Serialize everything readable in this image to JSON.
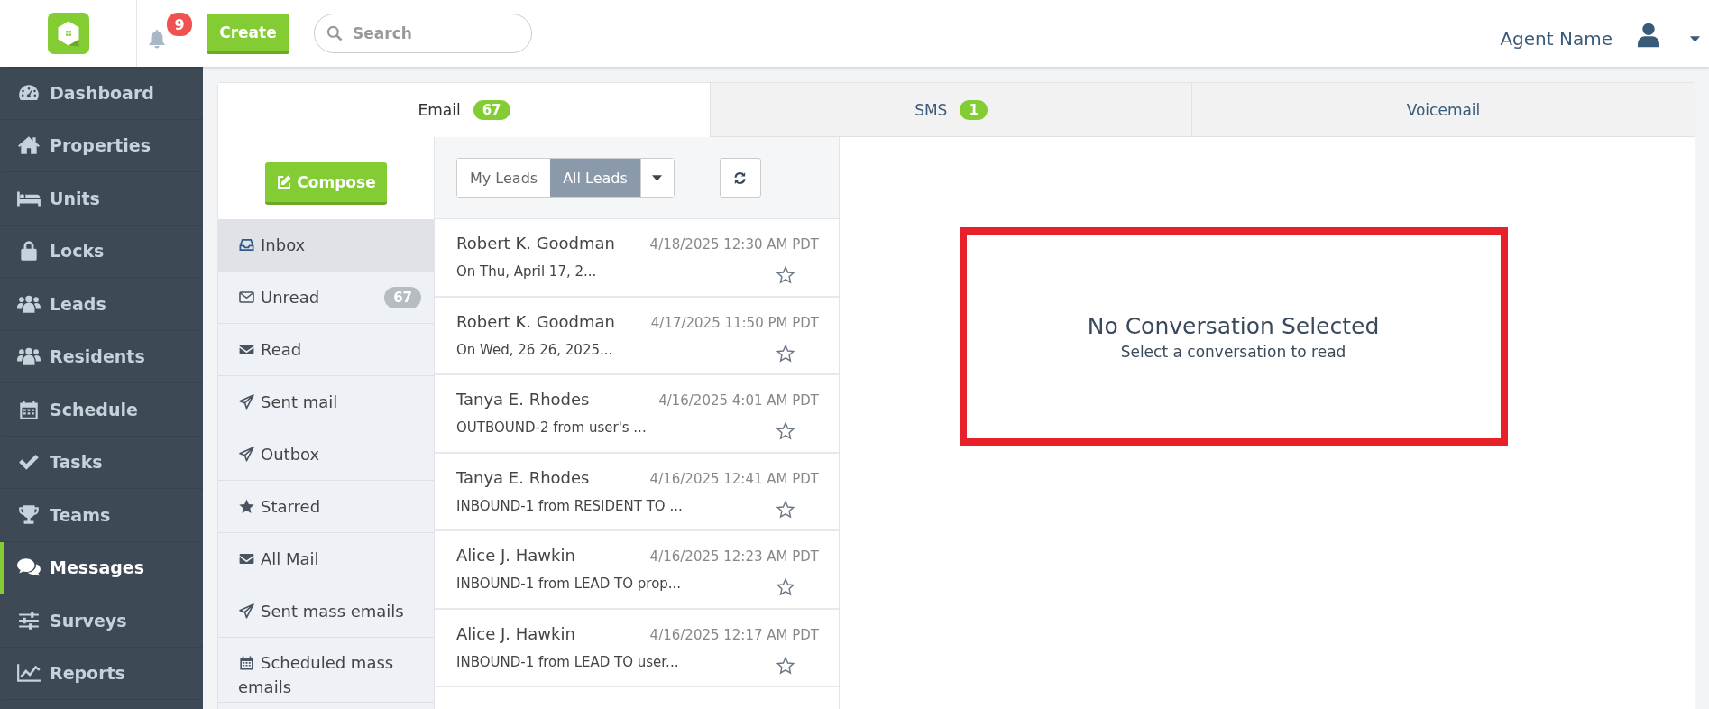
{
  "topbar": {
    "notifications_count": "9",
    "create_label": "Create",
    "search": {
      "placeholder": "Search"
    },
    "user_name": "Agent Name"
  },
  "sidebar": {
    "items": [
      {
        "label": "Dashboard",
        "selected": false
      },
      {
        "label": "Properties",
        "selected": false
      },
      {
        "label": "Units",
        "selected": false
      },
      {
        "label": "Locks",
        "selected": false
      },
      {
        "label": "Leads",
        "selected": false
      },
      {
        "label": "Residents",
        "selected": false
      },
      {
        "label": "Schedule",
        "selected": false
      },
      {
        "label": "Tasks",
        "selected": false
      },
      {
        "label": "Teams",
        "selected": false
      },
      {
        "label": "Messages",
        "selected": true
      },
      {
        "label": "Surveys",
        "selected": false
      },
      {
        "label": "Reports",
        "selected": false
      }
    ]
  },
  "tabs": [
    {
      "label": "Email",
      "count": "67",
      "selected": true
    },
    {
      "label": "SMS",
      "count": "1",
      "selected": false
    },
    {
      "label": "Voicemail",
      "selected": false
    }
  ],
  "folders": {
    "compose_label": "Compose",
    "items": [
      {
        "label": "Inbox",
        "selected": true
      },
      {
        "label": "Unread",
        "count": "67",
        "selected": false
      },
      {
        "label": "Read",
        "selected": false
      },
      {
        "label": "Sent mail",
        "selected": false
      },
      {
        "label": "Outbox",
        "selected": false
      },
      {
        "label": "Starred",
        "selected": false
      },
      {
        "label": "All Mail",
        "selected": false
      },
      {
        "label": "Sent mass emails",
        "selected": false
      },
      {
        "label": "Scheduled mass emails",
        "selected": false
      }
    ]
  },
  "lead_filter": {
    "options": [
      {
        "label": "My Leads",
        "selected": false
      },
      {
        "label": "All Leads",
        "selected": true
      }
    ]
  },
  "messages": [
    {
      "sender": "Robert K. Goodman",
      "date": "4/18/2025 12:30 AM PDT",
      "preview": "On Thu, April 17, 2...",
      "starred": false
    },
    {
      "sender": "Robert K. Goodman",
      "date": "4/17/2025 11:50 PM PDT",
      "preview": "On Wed, 26 26, 2025...",
      "starred": false
    },
    {
      "sender": "Tanya E. Rhodes",
      "date": "4/16/2025 4:01 AM PDT",
      "preview": "OUTBOUND-2 from user's ...",
      "starred": false
    },
    {
      "sender": "Tanya E. Rhodes",
      "date": "4/16/2025 12:41 AM PDT",
      "preview": "INBOUND-1 from RESIDENT TO ...",
      "starred": false
    },
    {
      "sender": "Alice J. Hawkin",
      "date": "4/16/2025 12:23 AM PDT",
      "preview": "INBOUND-1 from LEAD TO prop...",
      "starred": false
    },
    {
      "sender": "Alice J. Hawkin",
      "date": "4/16/2025 12:17 AM PDT",
      "preview": "INBOUND-1 from LEAD TO user...",
      "starred": false
    }
  ],
  "empty_state": {
    "title": "No Conversation Selected",
    "subtitle": "Select a conversation to read"
  }
}
